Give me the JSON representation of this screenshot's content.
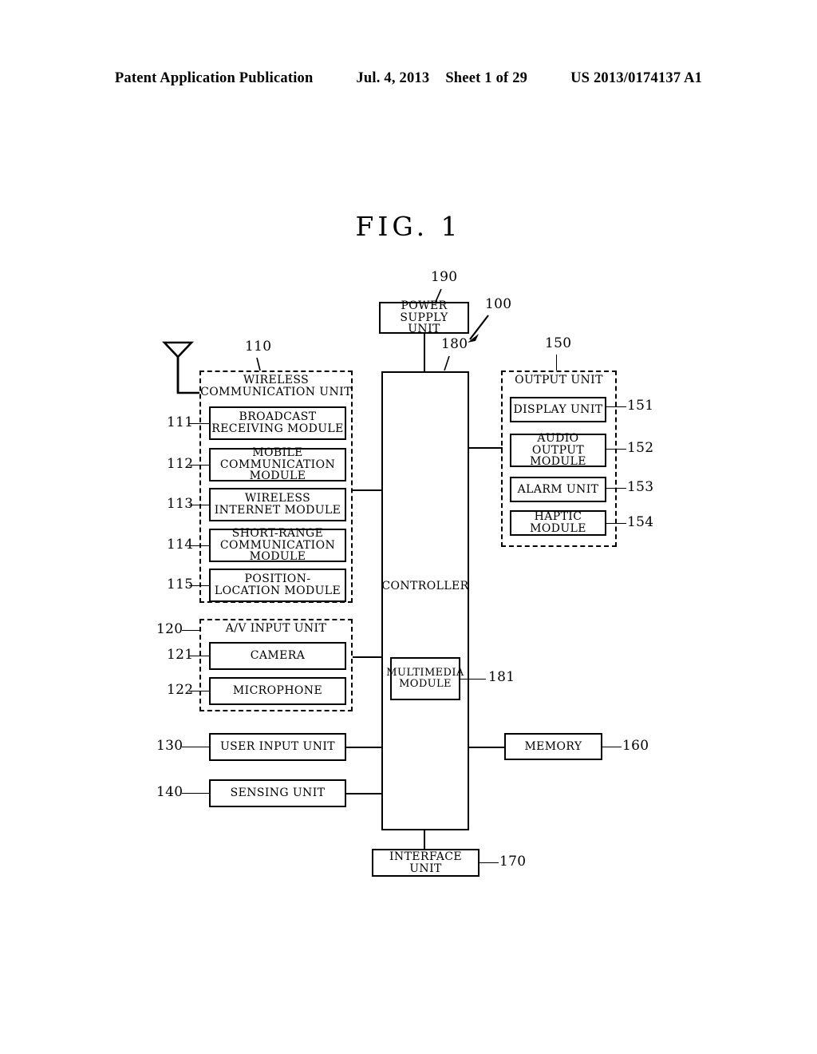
{
  "header": {
    "publication": "Patent Application Publication",
    "date": "Jul. 4, 2013",
    "sheet": "Sheet 1 of 29",
    "patent_number": "US 2013/0174137 A1"
  },
  "figure": {
    "title": "FIG.  1",
    "device_ref": "100"
  },
  "power_supply": {
    "label": "POWER  SUPPLY\nUNIT",
    "ref": "190"
  },
  "controller": {
    "label": "CONTROLLER",
    "ref": "180",
    "multimedia_module": {
      "label": "MULTIMEDIA\nMODULE",
      "ref": "181"
    }
  },
  "wireless_communication_unit": {
    "label": "WIRELESS\nCOMMUNICATION UNIT",
    "ref": "110",
    "antenna": "antenna-icon",
    "modules": [
      {
        "label": "BROADCAST\nRECEIVING MODULE",
        "ref": "111"
      },
      {
        "label": "MOBILE\nCOMMUNICATION MODULE",
        "ref": "112"
      },
      {
        "label": "WIRELESS\nINTERNET MODULE",
        "ref": "113"
      },
      {
        "label": "SHORT-RANGE\nCOMMUNICATION MODULE",
        "ref": "114"
      },
      {
        "label": "POSITION-\nLOCATION MODULE",
        "ref": "115"
      }
    ]
  },
  "av_input_unit": {
    "label": "A/V  INPUT  UNIT",
    "ref": "120",
    "modules": [
      {
        "label": "CAMERA",
        "ref": "121"
      },
      {
        "label": "MICROPHONE",
        "ref": "122"
      }
    ]
  },
  "user_input_unit": {
    "label": "USER  INPUT  UNIT",
    "ref": "130"
  },
  "sensing_unit": {
    "label": "SENSING  UNIT",
    "ref": "140"
  },
  "output_unit": {
    "label": "OUTPUT  UNIT",
    "ref": "150",
    "modules": [
      {
        "label": "DISPLAY UNIT",
        "ref": "151"
      },
      {
        "label": "AUDIO OUTPUT\nMODULE",
        "ref": "152"
      },
      {
        "label": "ALARM UNIT",
        "ref": "153"
      },
      {
        "label": "HAPTIC MODULE",
        "ref": "154"
      }
    ]
  },
  "memory": {
    "label": "MEMORY",
    "ref": "160"
  },
  "interface_unit": {
    "label": "INTERFACE UNIT",
    "ref": "170"
  }
}
